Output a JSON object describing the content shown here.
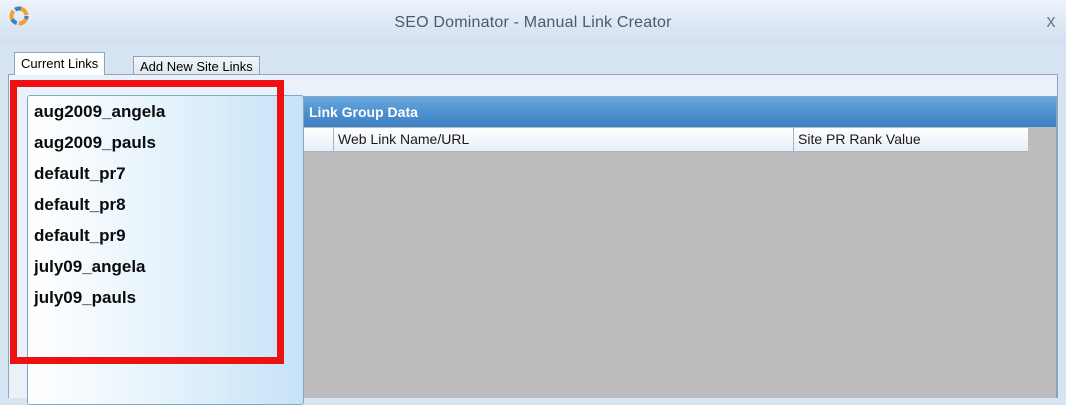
{
  "window": {
    "title": "SEO Dominator - Manual Link Creator",
    "close_symbol": "x"
  },
  "tabs": [
    {
      "label": "Current Links",
      "active": true
    },
    {
      "label": "Add New Site Links",
      "active": false
    }
  ],
  "link_groups": [
    "aug2009_angela",
    "aug2009_pauls",
    "default_pr7",
    "default_pr8",
    "default_pr9",
    "july09_angela",
    "july09_pauls"
  ],
  "group_data": {
    "header": "Link Group Data",
    "columns": [
      "Web Link Name/URL",
      "Site PR Rank Value"
    ]
  },
  "colors": {
    "highlight": "#ee1111",
    "header_blue": "#4c8fcf",
    "grid_empty": "#bcbcbc"
  }
}
